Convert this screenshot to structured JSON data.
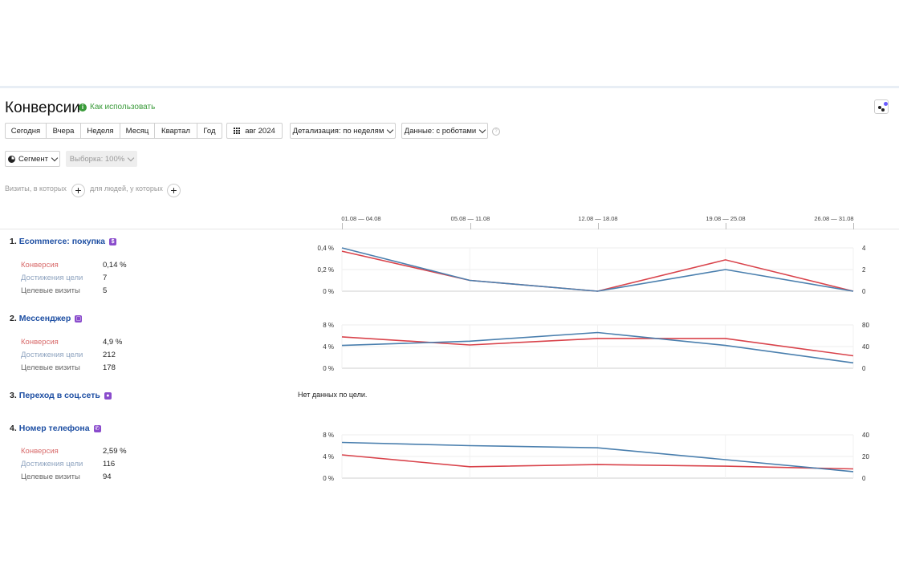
{
  "header": {
    "title": "Конверсии",
    "help_label": "Как использовать",
    "help_icon": "info-icon"
  },
  "toolbar": {
    "periods": [
      "Сегодня",
      "Вчера",
      "Неделя",
      "Месяц",
      "Квартал",
      "Год"
    ],
    "date_label": "авг 2024",
    "detail_label": "Детализация: по неделям",
    "data_label": "Данные: с роботами",
    "segment_label": "Сегмент",
    "sample_label": "Выборка: 100%"
  },
  "filters": {
    "visits_label": "Визиты, в которых",
    "people_label": "для людей, у которых"
  },
  "timeline": {
    "periods": [
      "01.08 — 04.08",
      "05.08 — 11.08",
      "12.08 — 18.08",
      "19.08 — 25.08",
      "26.08 — 31.08"
    ]
  },
  "goals": [
    {
      "num": "1.",
      "name": "Ecommerce: покупка",
      "icon": "ecommerce-icon",
      "conv_label": "Конверсия",
      "conv": "0,14 %",
      "reach_label": "Достижения цели",
      "reach": "7",
      "visits_label": "Целевые визиты",
      "visits": "5"
    },
    {
      "num": "2.",
      "name": "Мессенджер",
      "icon": "messenger-icon",
      "conv_label": "Конверсия",
      "conv": "4,9 %",
      "reach_label": "Достижения цели",
      "reach": "212",
      "visits_label": "Целевые визиты",
      "visits": "178"
    },
    {
      "num": "3.",
      "name": "Переход в соц.сеть",
      "icon": "social-icon",
      "no_data": "Нет данных по цели."
    },
    {
      "num": "4.",
      "name": "Номер телефона",
      "icon": "phone-icon",
      "conv_label": "Конверсия",
      "conv": "2,59 %",
      "reach_label": "Достижения цели",
      "reach": "116",
      "visits_label": "Целевые визиты",
      "visits": "94"
    }
  ],
  "colors": {
    "conversion": "#d9434b",
    "visits": "#4a7fae"
  },
  "chart_data": [
    {
      "type": "line",
      "goal": "Ecommerce: покупка",
      "x": [
        "01.08 — 04.08",
        "05.08 — 11.08",
        "12.08 — 18.08",
        "19.08 — 25.08",
        "26.08 — 31.08"
      ],
      "left_ticks": [
        "0 %",
        "0,2 %",
        "0,4 %"
      ],
      "right_ticks": [
        "0",
        "2",
        "4"
      ],
      "left_ylim": [
        0,
        0.4
      ],
      "right_ylim": [
        0,
        4
      ],
      "series": [
        {
          "name": "Конверсия",
          "axis": "left",
          "values": [
            0.37,
            0.1,
            0.0,
            0.29,
            0.0
          ]
        },
        {
          "name": "Целевые визиты",
          "axis": "right",
          "values": [
            4,
            1,
            0,
            2,
            0
          ]
        }
      ]
    },
    {
      "type": "line",
      "goal": "Мессенджер",
      "x": [
        "01.08 — 04.08",
        "05.08 — 11.08",
        "12.08 — 18.08",
        "19.08 — 25.08",
        "26.08 — 31.08"
      ],
      "left_ticks": [
        "0 %",
        "4 %",
        "8 %"
      ],
      "right_ticks": [
        "0",
        "40",
        "80"
      ],
      "left_ylim": [
        0,
        8
      ],
      "right_ylim": [
        0,
        80
      ],
      "series": [
        {
          "name": "Конверсия",
          "axis": "left",
          "values": [
            5.8,
            4.3,
            5.5,
            5.5,
            2.3
          ]
        },
        {
          "name": "Целевые визиты",
          "axis": "right",
          "values": [
            42,
            50,
            66,
            42,
            10
          ]
        }
      ]
    },
    {
      "type": "line",
      "goal": "Номер телефона",
      "x": [
        "01.08 — 04.08",
        "05.08 — 11.08",
        "12.08 — 18.08",
        "19.08 — 25.08",
        "26.08 — 31.08"
      ],
      "left_ticks": [
        "0 %",
        "4 %",
        "8 %"
      ],
      "right_ticks": [
        "0",
        "20",
        "40"
      ],
      "left_ylim": [
        0,
        8
      ],
      "right_ylim": [
        0,
        40
      ],
      "series": [
        {
          "name": "Конверсия",
          "axis": "left",
          "values": [
            4.3,
            2.1,
            2.5,
            2.2,
            1.7
          ]
        },
        {
          "name": "Целевые визиты",
          "axis": "right",
          "values": [
            33,
            30,
            28,
            17,
            6
          ]
        }
      ]
    }
  ]
}
